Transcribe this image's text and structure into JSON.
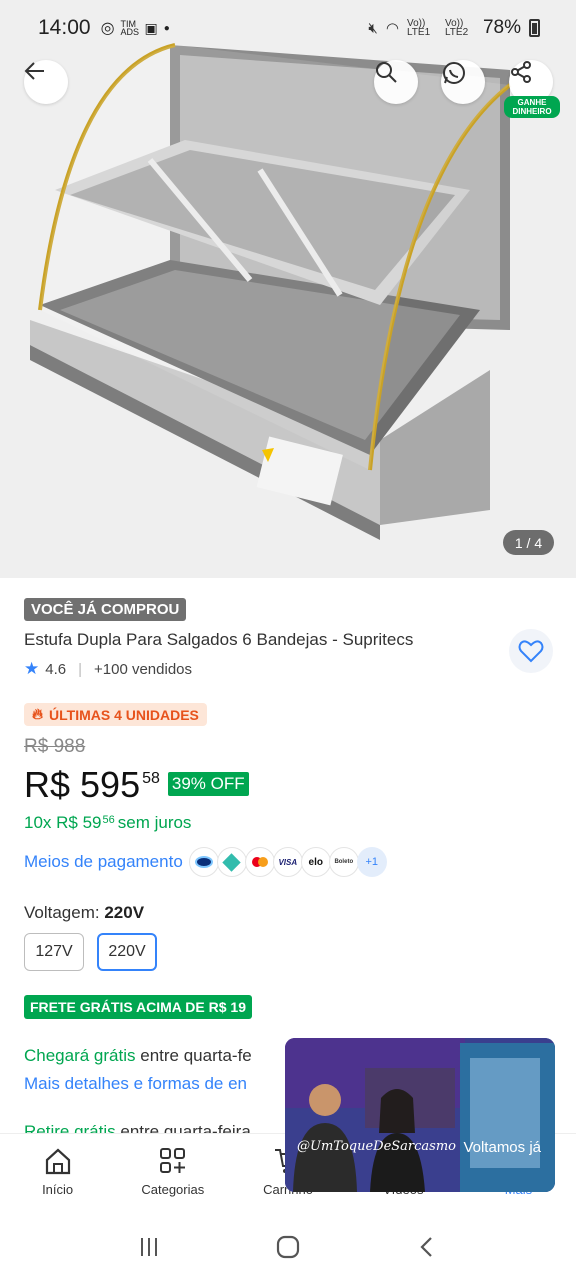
{
  "status_bar": {
    "time": "14:00",
    "signal_text_1": "Vo)) LTE1",
    "signal_text_2": "Vo)) LTE2",
    "battery": "78%",
    "small_text": "TIM ADS"
  },
  "gallery": {
    "pager": "1 / 4",
    "share_badge": "GANHE DINHEIRO"
  },
  "product": {
    "bought_badge": "VOCÊ JÁ COMPROU",
    "title": "Estufa Dupla Para Salgados 6 Bandejas - Supritecs",
    "rating": "4.6",
    "sold": "+100 vendidos",
    "stock_tag": "ÚLTIMAS 4 UNIDADES",
    "old_price": "R$ 988",
    "price_main": "R$ 595",
    "price_cents": "58",
    "discount": "39% OFF",
    "installment_prefix": "10x R$ 59",
    "installment_cents": "56",
    "installment_suffix": "sem juros",
    "payment_label": "Meios de pagamento",
    "payment_more": "+1",
    "payment_icons": [
      "mercadopago-icon",
      "pix-icon",
      "mastercard-icon",
      "visa-icon",
      "elo-icon",
      "boleto-icon"
    ],
    "visa_text": "VISA",
    "elo_text": "elo",
    "boleto_text": "Boleto",
    "voltage_label": "Voltagem:",
    "voltage_selected": "220V",
    "voltage_options": [
      "127V",
      "220V"
    ],
    "free_shipping_tag": "FRETE GRÁTIS ACIMA DE R$ 19",
    "ship_line1_green": "Chegará grátis",
    "ship_line1_rest": "entre quarta-fe",
    "ship_line2": "Mais detalhes e formas de en",
    "ship_line3_green": "Retire grátis",
    "ship_line3_rest": "entre quarta-feira"
  },
  "video_popup": {
    "handle": "@UmToqueDeSarcasmo",
    "message": "Voltamos já"
  },
  "bottom_nav": {
    "items": [
      "Início",
      "Categorias",
      "Carrinho",
      "Vídeos",
      "Mais"
    ]
  },
  "colors": {
    "accent_blue": "#3483fa",
    "green": "#00a650",
    "orange": "#e7531c"
  }
}
